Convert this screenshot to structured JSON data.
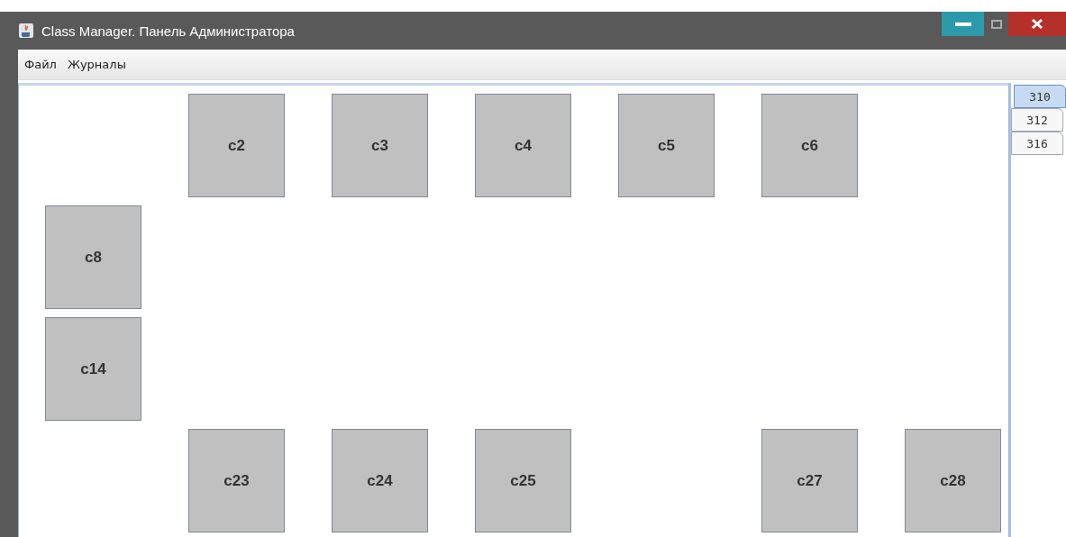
{
  "window": {
    "title": "Class Manager. Панель Администратора"
  },
  "menu": [
    "Файл",
    "Журналы"
  ],
  "seat_rows": [
    {
      "cells": [
        {
          "kind": "empty"
        },
        {
          "kind": "seat",
          "label": "c2"
        },
        {
          "kind": "seat",
          "label": "c3"
        },
        {
          "kind": "seat",
          "label": "c4"
        },
        {
          "kind": "seat",
          "label": "c5"
        },
        {
          "kind": "seat",
          "label": "c6"
        },
        {
          "kind": "empty"
        }
      ]
    },
    {
      "cells": [
        {
          "kind": "seat",
          "label": "c8"
        }
      ]
    },
    {
      "cells": [
        {
          "kind": "seat",
          "label": "c14"
        }
      ]
    },
    {
      "cells": [
        {
          "kind": "empty"
        },
        {
          "kind": "seat",
          "label": "c23"
        },
        {
          "kind": "seat",
          "label": "c24"
        },
        {
          "kind": "seat",
          "label": "c25"
        },
        {
          "kind": "empty"
        },
        {
          "kind": "seat",
          "label": "c27"
        },
        {
          "kind": "seat",
          "label": "c28"
        }
      ]
    }
  ],
  "room_tabs": [
    {
      "label": "310",
      "selected": true
    },
    {
      "label": "312",
      "selected": false
    },
    {
      "label": "316",
      "selected": false
    }
  ]
}
